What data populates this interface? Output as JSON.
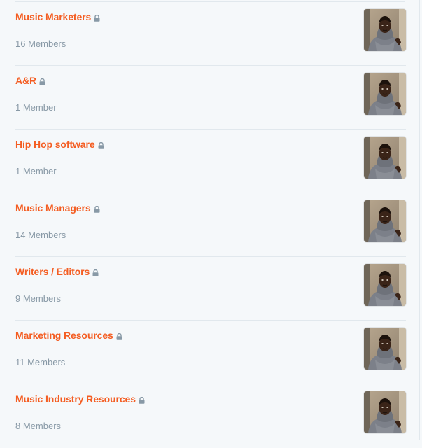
{
  "groups": [
    {
      "name": "Music Marketers",
      "members": "16 Members"
    },
    {
      "name": "A&R",
      "members": "1 Member"
    },
    {
      "name": "Hip Hop software",
      "members": "1 Member"
    },
    {
      "name": "Music Managers",
      "members": "14 Members"
    },
    {
      "name": "Writers / Editors",
      "members": "9 Members"
    },
    {
      "name": "Marketing Resources",
      "members": "11 Members"
    },
    {
      "name": "Music Industry Resources",
      "members": "8 Members"
    }
  ],
  "colors": {
    "accent": "#f45d22",
    "muted": "#8899a6",
    "background": "#f5f8fa",
    "divider": "#e1e8ed"
  },
  "icons": {
    "lock": "lock-icon",
    "avatar": "avatar"
  }
}
